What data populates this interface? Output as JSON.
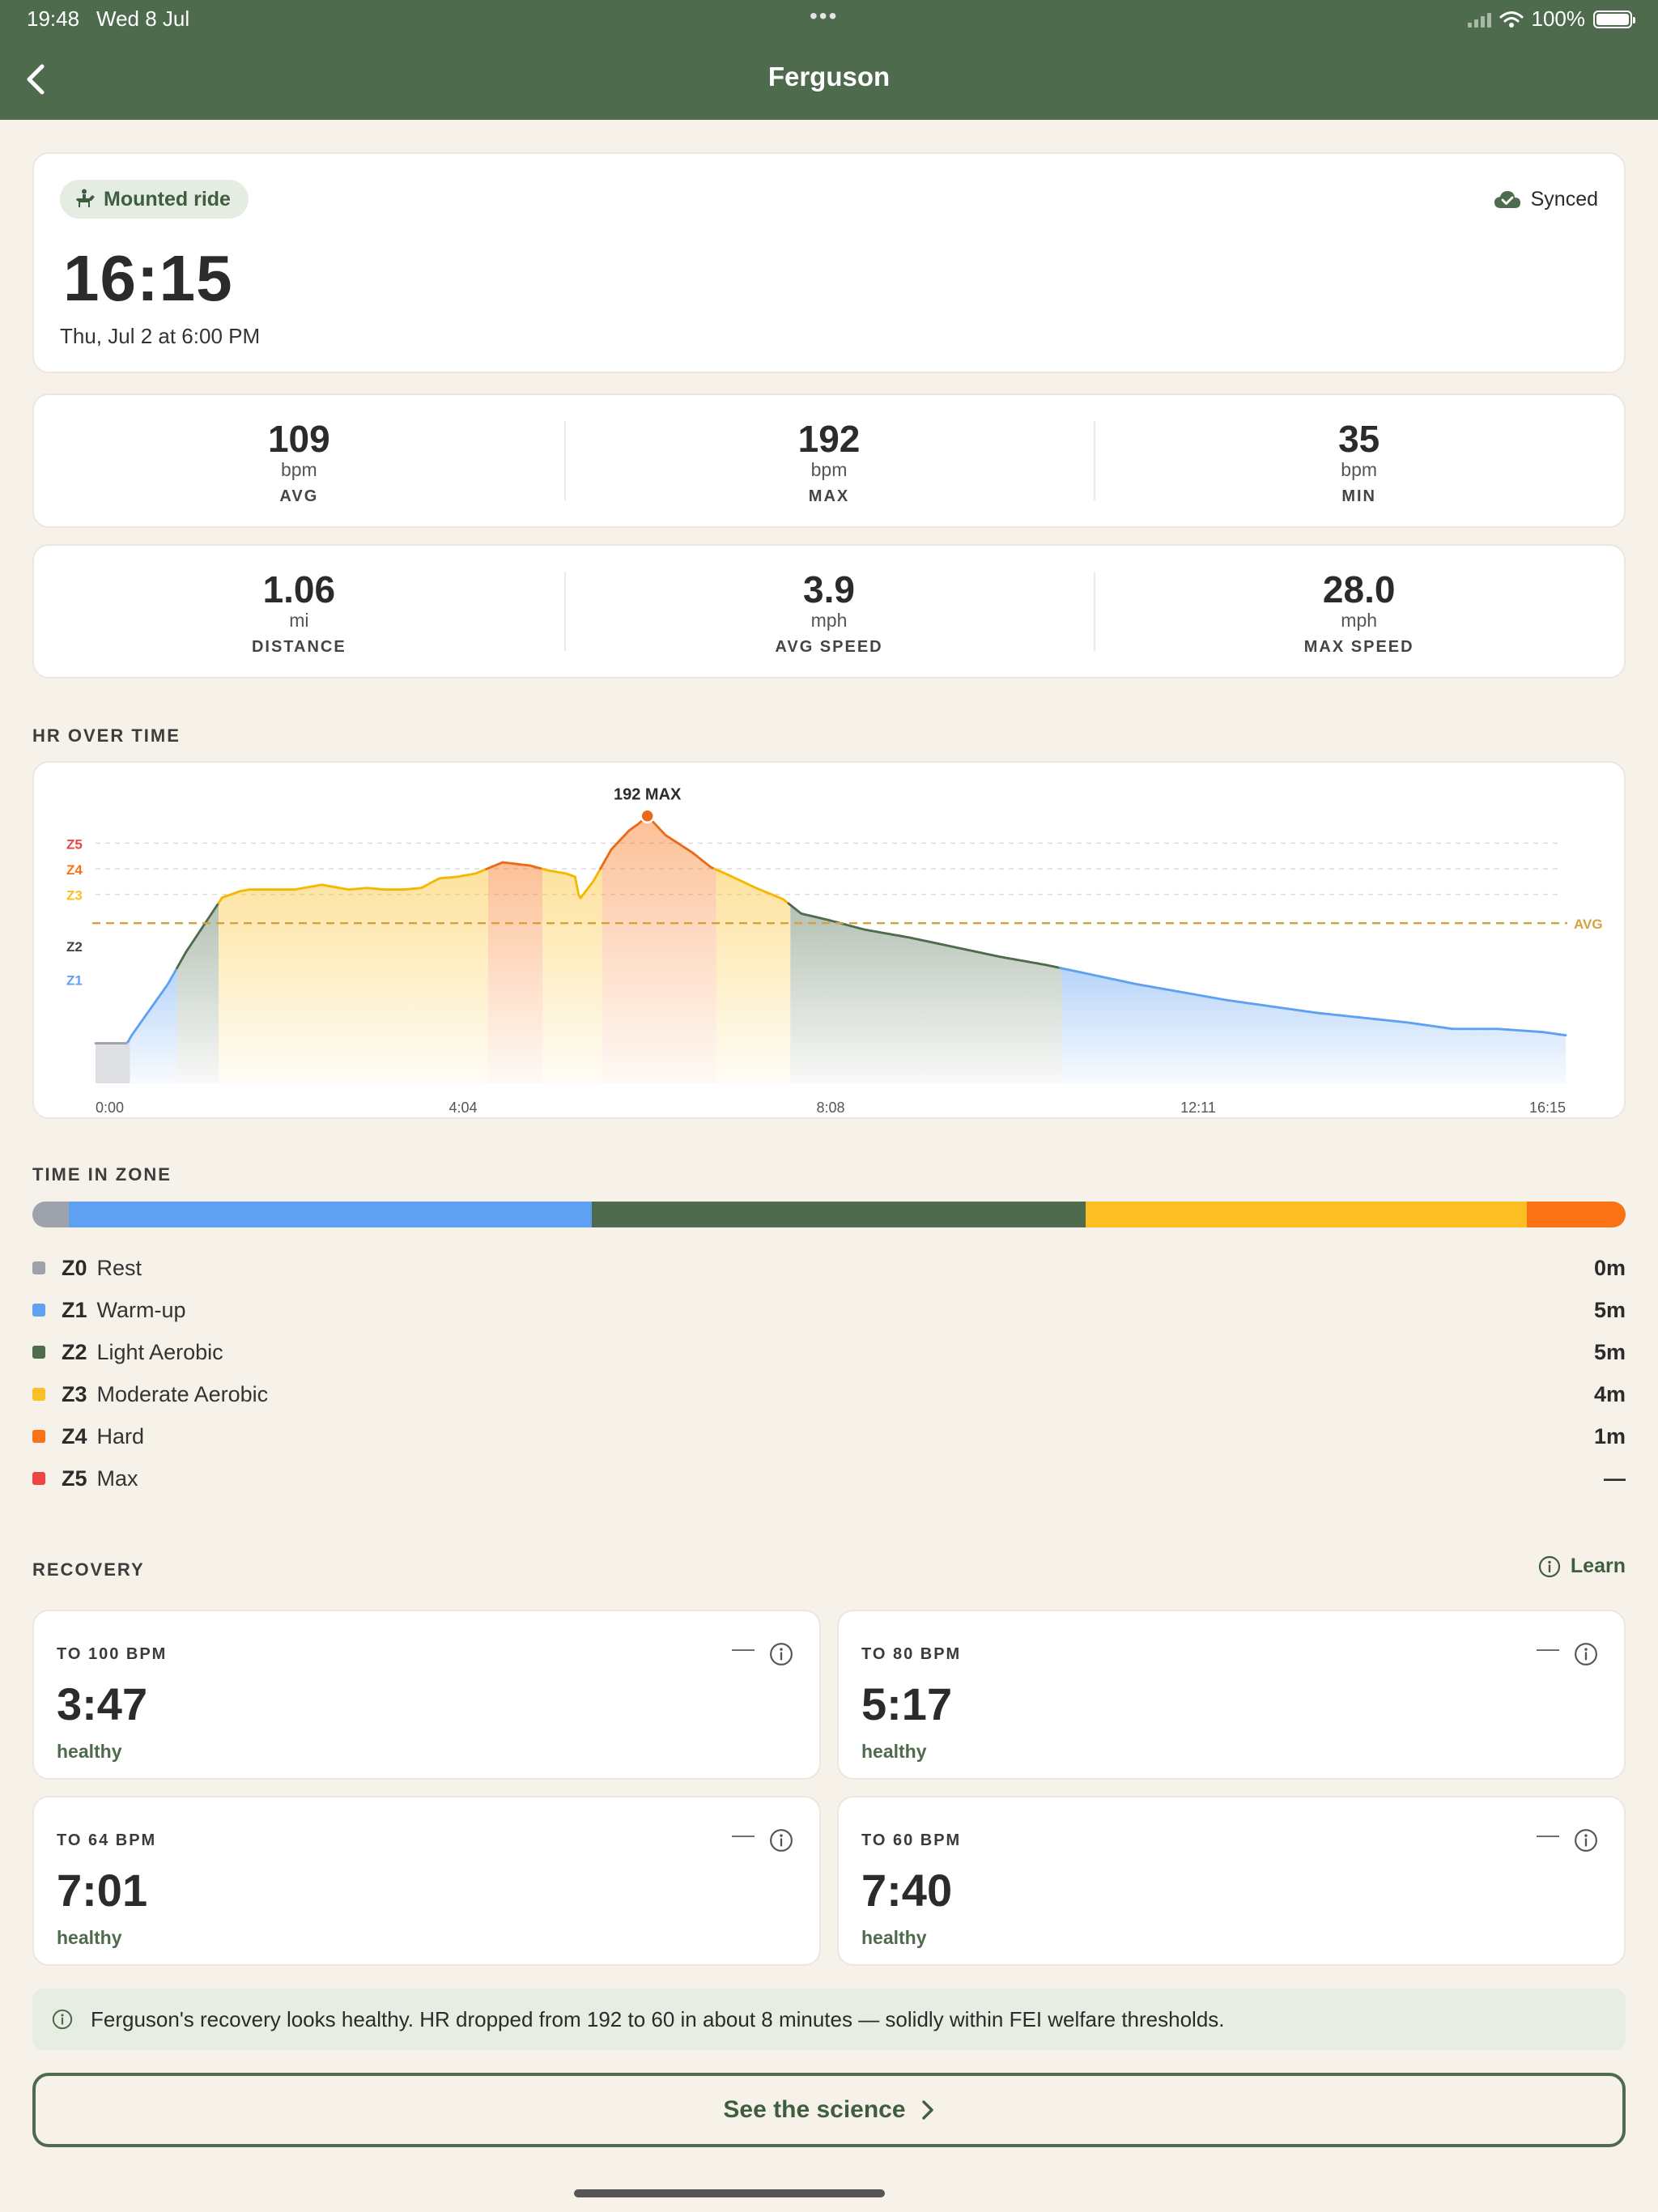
{
  "status": {
    "time": "19:48",
    "date": "Wed 8 Jul",
    "dots": "•••",
    "battery": "100%"
  },
  "nav": {
    "title": "Ferguson"
  },
  "summary": {
    "pill": "Mounted ride",
    "sync": "Synced",
    "duration": "16:15",
    "datetime": "Thu, Jul 2 at 6:00 PM"
  },
  "hr_stats": [
    {
      "value": "109",
      "unit": "bpm",
      "label": "AVG"
    },
    {
      "value": "192",
      "unit": "bpm",
      "label": "MAX"
    },
    {
      "value": "35",
      "unit": "bpm",
      "label": "MIN"
    }
  ],
  "move_stats": [
    {
      "value": "1.06",
      "unit": "mi",
      "label": "DISTANCE"
    },
    {
      "value": "3.9",
      "unit": "mph",
      "label": "AVG SPEED"
    },
    {
      "value": "28.0",
      "unit": "mph",
      "label": "MAX SPEED"
    }
  ],
  "sections": {
    "hr": "HR OVER TIME",
    "zone": "TIME IN ZONE",
    "recovery": "RECOVERY",
    "learn": "Learn"
  },
  "chart_data": {
    "type": "area",
    "title": "HR OVER TIME",
    "x_ticks": [
      "0:00",
      "4:04",
      "8:08",
      "12:11",
      "16:15"
    ],
    "xlim": [
      0,
      16.25
    ],
    "y_zone_labels": [
      "Z5",
      "Z4",
      "Z3",
      "Z2",
      "Z1"
    ],
    "avg_label": "AVG",
    "avg_value": 109,
    "max_label": "192 MAX",
    "max_point": {
      "x": 6.1,
      "y": 192
    },
    "zone_colors": {
      "Z0": "#9ea3ab",
      "Z1": "#5ea0f2",
      "Z2": "#4e6b4e",
      "Z3": "#fbbf24",
      "Z4": "#f97316",
      "Z5": "#ef4444"
    },
    "series": [
      {
        "x": [
          0,
          0.35,
          0.4,
          0.8,
          1.0,
          1.4,
          1.6,
          1.7,
          1.75,
          1.9,
          2.0,
          2.2,
          2.5,
          2.8,
          3.0,
          3.2,
          3.4,
          3.6,
          3.8,
          4.0,
          4.2,
          4.5,
          4.8,
          5.0,
          5.2,
          5.3,
          5.35,
          5.5,
          5.7,
          5.9,
          6.0,
          6.1,
          6.3,
          6.6,
          6.8,
          7.0,
          7.3,
          7.6,
          7.8,
          8.1,
          8.5,
          9.0,
          9.5,
          10.0,
          10.5,
          11.0,
          11.5,
          12.0,
          12.5,
          13.0,
          13.5,
          14.0,
          14.5,
          15.0,
          15.5,
          16.0,
          16.25
        ],
        "y": [
          25,
          25,
          30,
          62,
          82,
          116,
          120,
          121,
          121,
          121,
          121,
          121,
          124,
          121,
          122,
          121,
          121,
          122,
          128,
          129,
          131,
          138,
          136,
          133,
          131,
          129,
          115,
          126,
          146,
          158,
          162,
          167,
          155,
          144,
          135,
          130,
          122,
          115,
          106,
          102,
          96,
          91,
          85,
          79,
          74,
          68,
          62,
          57,
          52,
          48,
          44,
          41,
          38,
          34,
          34,
          32,
          30
        ]
      }
    ]
  },
  "time_in_zone": {
    "segments": [
      {
        "zone": "Z0",
        "fraction": 0.023,
        "color": "#9ea3ab"
      },
      {
        "zone": "Z1",
        "fraction": 0.328,
        "color": "#5ea0f2"
      },
      {
        "zone": "Z2",
        "fraction": 0.31,
        "color": "#4e6b4e"
      },
      {
        "zone": "Z3",
        "fraction": 0.277,
        "color": "#fbbf24"
      },
      {
        "zone": "Z4",
        "fraction": 0.062,
        "color": "#f97316"
      }
    ],
    "rows": [
      {
        "code": "Z0",
        "name": "Rest",
        "value": "0m",
        "color": "#9ea3ab"
      },
      {
        "code": "Z1",
        "name": "Warm-up",
        "value": "5m",
        "color": "#5ea0f2"
      },
      {
        "code": "Z2",
        "name": "Light Aerobic",
        "value": "5m",
        "color": "#4e6b4e"
      },
      {
        "code": "Z3",
        "name": "Moderate Aerobic",
        "value": "4m",
        "color": "#fbbf24"
      },
      {
        "code": "Z4",
        "name": "Hard",
        "value": "1m",
        "color": "#f97316"
      },
      {
        "code": "Z5",
        "name": "Max",
        "value": "—",
        "color": "#ef4444"
      }
    ]
  },
  "recovery": [
    {
      "label": "TO 100 BPM",
      "dash": "—",
      "value": "3:47",
      "status": "healthy"
    },
    {
      "label": "TO 80 BPM",
      "dash": "—",
      "value": "5:17",
      "status": "healthy"
    },
    {
      "label": "TO 64 BPM",
      "dash": "—",
      "value": "7:01",
      "status": "healthy"
    },
    {
      "label": "TO 60 BPM",
      "dash": "—",
      "value": "7:40",
      "status": "healthy"
    }
  ],
  "note": "Ferguson's recovery looks healthy. HR dropped from 192 to 60 in about 8 minutes — solidly within FEI welfare thresholds.",
  "cta": "See the science"
}
